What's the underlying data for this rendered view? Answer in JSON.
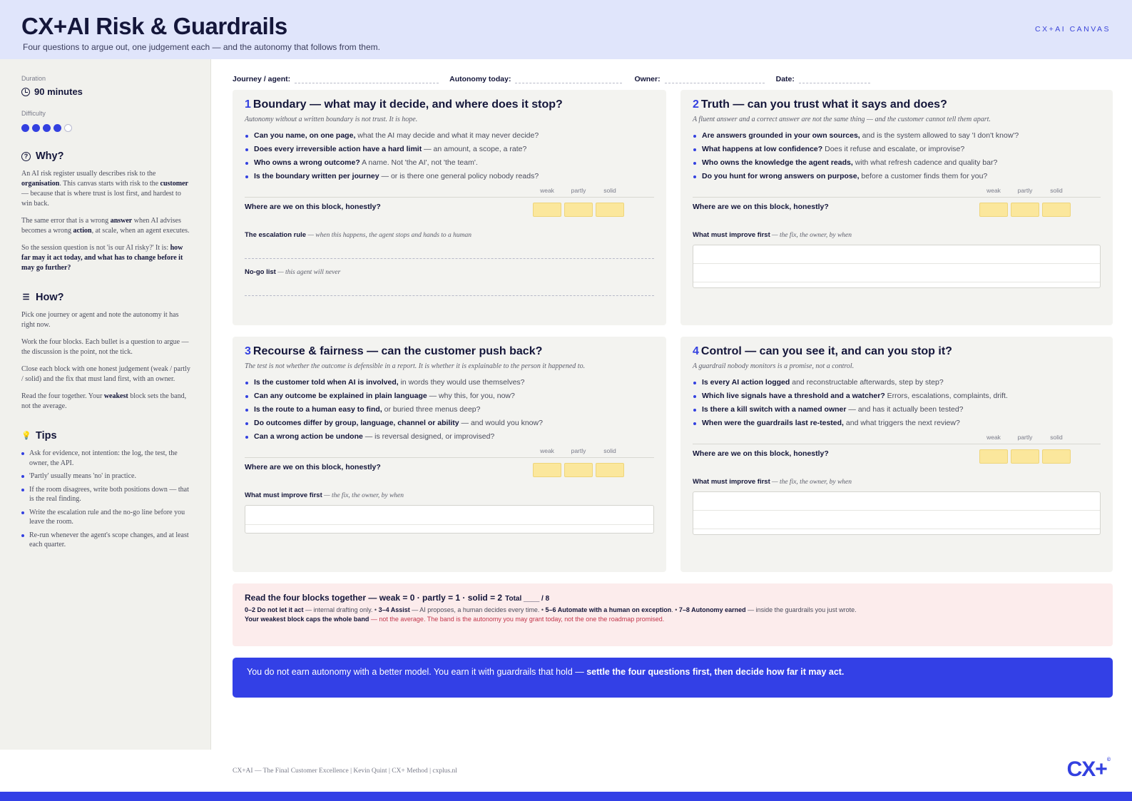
{
  "header": {
    "title": "CX+AI Risk & Guardrails",
    "subtitle": "Four questions to argue out, one judgement each — and the autonomy that follows from them.",
    "tag": "CX+AI CANVAS"
  },
  "sidebar": {
    "duration_label": "Duration",
    "duration_value": "90 minutes",
    "difficulty_label": "Difficulty",
    "difficulty_level": 4,
    "difficulty_max": 5,
    "why": {
      "heading": "Why?",
      "p1_a": "An AI risk register usually describes risk to the ",
      "p1_b": "organisation",
      "p1_c": ". This canvas starts with risk to the ",
      "p1_d": "customer",
      "p1_e": " — because that is where trust is lost first, and hardest to win back.",
      "p2_a": "The same error that is a wrong ",
      "p2_b": "answer",
      "p2_c": " when AI advises becomes a wrong ",
      "p2_d": "action",
      "p2_e": ", at scale, when an agent executes.",
      "p3_a": "So the session question is not 'is our AI risky?' It is: ",
      "p3_b": "how far may it act today, and what has to change before it may go further?"
    },
    "how": {
      "heading": "How?",
      "p1": "Pick one journey or agent and note the autonomy it has right now.",
      "p2": "Work the four blocks. Each bullet is a question to argue — the discussion is the point, not the tick.",
      "p3": "Close each block with one honest judgement (weak / partly / solid) and the fix that must land first, with an owner.",
      "p4_a": "Read the four together. Your ",
      "p4_b": "weakest",
      "p4_c": " block sets the band, not the average."
    },
    "tips": {
      "heading": "Tips",
      "items": [
        "Ask for evidence, not intention: the log, the test, the owner, the API.",
        "'Partly' usually means 'no' in practice.",
        "If the room disagrees, write both positions down — that is the real finding.",
        "Write the escalation rule and the no-go line before you leave the room.",
        "Re-run whenever the agent's scope changes, and at least each quarter."
      ]
    }
  },
  "meta": {
    "journey": "Journey / agent:",
    "autonomy": "Autonomy today:",
    "owner": "Owner:",
    "date": "Date:"
  },
  "scale": {
    "weak": "weak",
    "partly": "partly",
    "solid": "solid"
  },
  "rating_question": "Where are we on this block, honestly?",
  "improve": {
    "label": "What must improve first",
    "hint": " — the fix, the owner, by when"
  },
  "blocks": [
    {
      "num": "1",
      "title": "Boundary — what may it decide, and where does it stop?",
      "sub": "Autonomy without a written boundary is not trust. It is hope.",
      "items": [
        {
          "b": "Can you name, on one page,",
          "t": " what the AI may decide and what it may never decide?"
        },
        {
          "b": "Does every irreversible action have a hard limit",
          "t": " — an amount, a scope, a rate?"
        },
        {
          "b": "Who owns a wrong outcome?",
          "t": " A name. Not 'the AI', not 'the team'."
        },
        {
          "b": "Is the boundary written per journey",
          "t": " — or is there one general policy nobody reads?"
        }
      ],
      "field1_label": "The escalation rule",
      "field1_hint": " — when this happens, the agent stops and hands to a human",
      "field2_label": "No-go list",
      "field2_hint": " — this agent will never"
    },
    {
      "num": "2",
      "title": "Truth — can you trust what it says and does?",
      "sub": "A fluent answer and a correct answer are not the same thing — and the customer cannot tell them apart.",
      "items": [
        {
          "b": "Are answers grounded in your own sources,",
          "t": " and is the system allowed to say 'I don't know'?"
        },
        {
          "b": "What happens at low confidence?",
          "t": " Does it refuse and escalate, or improvise?"
        },
        {
          "b": "Who owns the knowledge the agent reads,",
          "t": " with what refresh cadence and quality bar?"
        },
        {
          "b": "Do you hunt for wrong answers on purpose,",
          "t": " before a customer finds them for you?"
        }
      ]
    },
    {
      "num": "3",
      "title": "Recourse & fairness — can the customer push back?",
      "sub": "The test is not whether the outcome is defensible in a report. It is whether it is explainable to the person it happened to.",
      "items": [
        {
          "b": "Is the customer told when AI is involved,",
          "t": " in words they would use themselves?"
        },
        {
          "b": "Can any outcome be explained in plain language",
          "t": " — why this, for you, now?"
        },
        {
          "b": "Is the route to a human easy to find,",
          "t": " or buried three menus deep?"
        },
        {
          "b": "Do outcomes differ by group, language, channel or ability",
          "t": " — and would you know?"
        },
        {
          "b": "Can a wrong action be undone",
          "t": " — is reversal designed, or improvised?"
        }
      ]
    },
    {
      "num": "4",
      "title": "Control — can you see it, and can you stop it?",
      "sub": "A guardrail nobody monitors is a promise, not a control.",
      "items": [
        {
          "b": "Is every AI action logged",
          "t": " and reconstructable afterwards, step by step?"
        },
        {
          "b": "Which live signals have a threshold and a watcher?",
          "t": " Errors, escalations, complaints, drift."
        },
        {
          "b": "Is there a kill switch with a named owner",
          "t": " — and has it actually been tested?"
        },
        {
          "b": "When were the guardrails last re-tested,",
          "t": " and what triggers the next review?"
        }
      ]
    }
  ],
  "score": {
    "title": "Read the four blocks together  —  weak = 0 · partly = 1 · solid = 2",
    "total": "Total ____ / 8",
    "band1_b": "0–2  Do not let it act",
    "band1_t": " — internal drafting only.  •  ",
    "band2_b": "3–4  Assist",
    "band2_t": " — AI proposes, a human decides every time.  •  ",
    "band3_b": "5–6  Automate with a human on exception",
    "band3_t": ".  •  ",
    "band4_b": "7–8  Autonomy earned",
    "band4_t": " — inside the guardrails you just wrote.",
    "cap_b": "Your weakest block caps the whole band",
    "cap_t": " — not the average. The band is the autonomy you may grant today, not the one the roadmap promised."
  },
  "banner": {
    "text": "You do not earn autonomy with a better model. You earn it with guardrails that hold — ",
    "bold": "settle the four questions first, then decide how far it may act."
  },
  "footer": {
    "text": "CX+AI  —  The Final Customer Excellence  |  Kevin Quint  |  CX+ Method  |  cxplus.nl",
    "logo": "CX+",
    "logo_mark": "©"
  },
  "colors": {
    "accent": "#3340e6",
    "header_bg": "#e0e5fb",
    "rating_box": "#fbe79c",
    "score_bg": "#fcecec"
  }
}
